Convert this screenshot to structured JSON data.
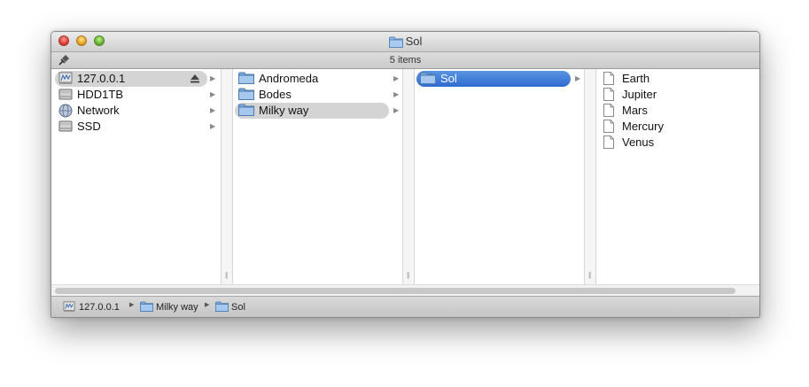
{
  "window": {
    "title": "Sol",
    "status": "5 items"
  },
  "columns": [
    {
      "items": [
        {
          "label": "127.0.0.1",
          "icon": "network-volume-icon",
          "selected": true,
          "has_eject": true
        },
        {
          "label": "HDD1TB",
          "icon": "hard-drive-icon"
        },
        {
          "label": "Network",
          "icon": "network-globe-icon"
        },
        {
          "label": "SSD",
          "icon": "hard-drive-icon"
        }
      ]
    },
    {
      "items": [
        {
          "label": "Andromeda",
          "icon": "folder-icon"
        },
        {
          "label": "Bodes",
          "icon": "folder-icon"
        },
        {
          "label": "Milky way",
          "icon": "folder-icon",
          "selected": true
        }
      ]
    },
    {
      "items": [
        {
          "label": "Sol",
          "icon": "folder-icon",
          "selected": true,
          "active": true
        }
      ]
    },
    {
      "items": [
        {
          "label": "Earth",
          "icon": "document-icon"
        },
        {
          "label": "Jupiter",
          "icon": "document-icon"
        },
        {
          "label": "Mars",
          "icon": "document-icon"
        },
        {
          "label": "Mercury",
          "icon": "document-icon"
        },
        {
          "label": "Venus",
          "icon": "document-icon"
        }
      ]
    }
  ],
  "pathbar": {
    "crumbs": [
      {
        "label": "127.0.0.1",
        "icon": "network-volume-icon"
      },
      {
        "label": "Milky way",
        "icon": "folder-icon"
      },
      {
        "label": "Sol",
        "icon": "folder-icon"
      }
    ]
  },
  "colors": {
    "selection_blue": "#3a76d6",
    "selection_grey": "#d4d4d4",
    "folder_blue": "#8fb8e6"
  }
}
